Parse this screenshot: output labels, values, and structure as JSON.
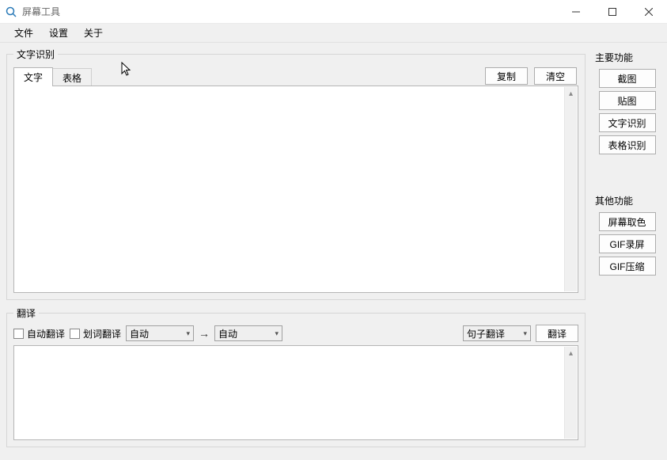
{
  "window": {
    "title": "屏幕工具"
  },
  "menubar": {
    "file": "文件",
    "settings": "设置",
    "about": "关于"
  },
  "ocr": {
    "legend": "文字识别",
    "tab_text": "文字",
    "tab_table": "表格",
    "copy_btn": "复制",
    "clear_btn": "清空"
  },
  "translate": {
    "legend": "翻译",
    "auto_translate_label": "自动翻译",
    "word_translate_label": "划词翻译",
    "src_lang": "自动",
    "dst_lang": "自动",
    "mode": "句子翻译",
    "translate_btn": "翻译"
  },
  "side": {
    "main_title": "主要功能",
    "screenshot": "截图",
    "paste_image": "贴图",
    "text_ocr": "文字识别",
    "table_ocr": "表格识别",
    "other_title": "其他功能",
    "color_picker": "屏幕取色",
    "gif_record": "GIF录屏",
    "gif_compress": "GIF压缩"
  }
}
